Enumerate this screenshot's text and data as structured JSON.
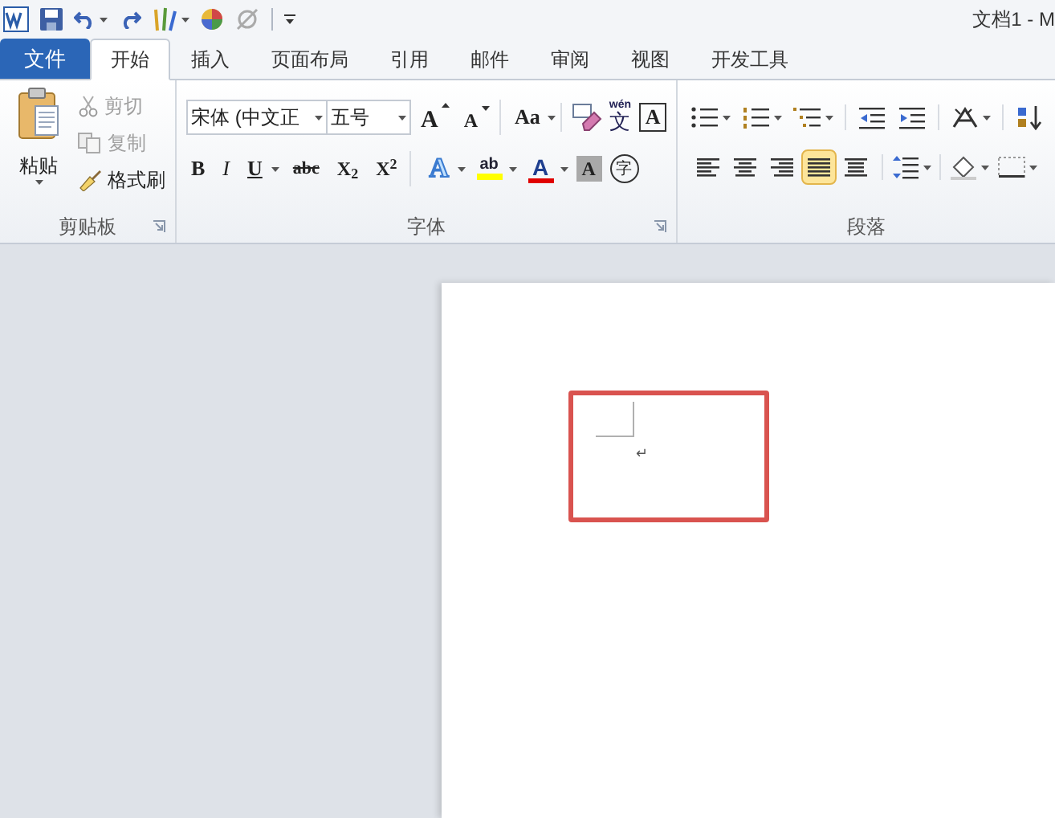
{
  "window": {
    "title": "文档1 - M"
  },
  "tabs": [
    {
      "label": "文件",
      "kind": "file",
      "selected": false
    },
    {
      "label": "开始",
      "kind": "tab",
      "selected": true
    },
    {
      "label": "插入",
      "kind": "tab",
      "selected": false
    },
    {
      "label": "页面布局",
      "kind": "tab",
      "selected": false
    },
    {
      "label": "引用",
      "kind": "tab",
      "selected": false
    },
    {
      "label": "邮件",
      "kind": "tab",
      "selected": false
    },
    {
      "label": "审阅",
      "kind": "tab",
      "selected": false
    },
    {
      "label": "视图",
      "kind": "tab",
      "selected": false
    },
    {
      "label": "开发工具",
      "kind": "tab",
      "selected": false
    }
  ],
  "clipboard": {
    "paste": "粘贴",
    "items": [
      {
        "label": "剪切",
        "kind": "cut",
        "disabled": true
      },
      {
        "label": "复制",
        "kind": "copy",
        "disabled": true
      },
      {
        "label": "格式刷",
        "kind": "painter",
        "disabled": false
      }
    ],
    "group_label": "剪贴板"
  },
  "font": {
    "font_name": "宋体 (中文正",
    "font_size": "五号",
    "row1": [
      {
        "kind": "grow",
        "label": "A"
      },
      {
        "kind": "shrink",
        "label": "A"
      },
      {
        "kind": "case",
        "label": "Aa"
      },
      {
        "kind": "clear"
      },
      {
        "kind": "phonetic",
        "label": "wén",
        "base": "文"
      },
      {
        "kind": "border",
        "label": "A"
      }
    ],
    "row2": [
      {
        "kind": "bold",
        "label": "B"
      },
      {
        "kind": "italic",
        "label": "I"
      },
      {
        "kind": "underline",
        "label": "U"
      },
      {
        "kind": "strike",
        "label": "abc"
      },
      {
        "kind": "sub",
        "label": "X$_{2}$"
      },
      {
        "kind": "sup",
        "label": "X$^{2}$"
      },
      {
        "kind": "effect",
        "label": "A"
      },
      {
        "kind": "highlight",
        "label": "ab"
      },
      {
        "kind": "color",
        "label": "A"
      },
      {
        "kind": "shade",
        "label": "A"
      },
      {
        "kind": "enclose",
        "label": "字"
      }
    ],
    "group_label": "字体"
  },
  "paragraph": {
    "alignments": [
      {
        "kind": "left",
        "selected": false
      },
      {
        "kind": "center",
        "selected": false
      },
      {
        "kind": "right",
        "selected": false
      },
      {
        "kind": "justify",
        "selected": true
      },
      {
        "kind": "distributed",
        "selected": false
      }
    ],
    "group_label": "段落"
  },
  "document": {
    "paragraph_mark": "↵"
  }
}
